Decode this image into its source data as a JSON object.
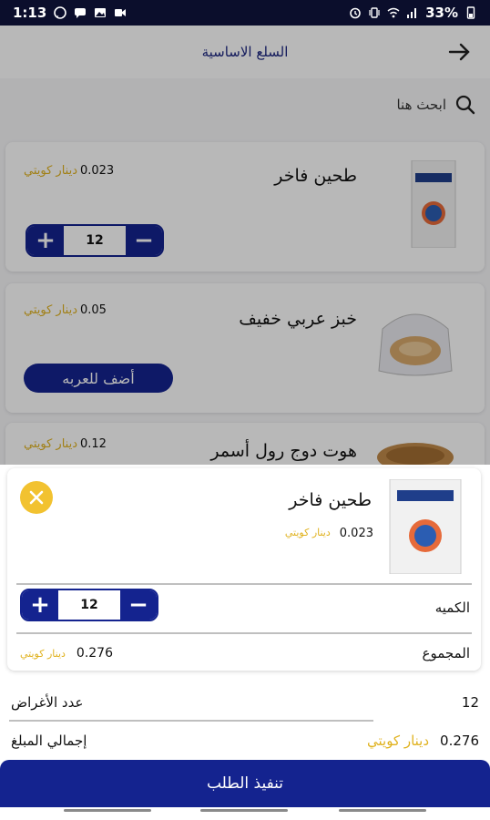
{
  "status_bar": {
    "time": "1:13",
    "battery": "33%",
    "icons": [
      "whatsapp-icon",
      "chat-icon",
      "gallery-icon",
      "video-icon",
      "alarm-icon",
      "vibrate-icon",
      "wifi-icon",
      "signal-icon",
      "battery-icon"
    ]
  },
  "header": {
    "title": "السلع الاساسية"
  },
  "search": {
    "placeholder": "ابحث هنا"
  },
  "products": [
    {
      "name": "طحين فاخر",
      "price": "0.023",
      "currency": "دينار كويتي",
      "quantity": "12",
      "thumb": "flour-bag"
    },
    {
      "name": "خبز عربي خفيف",
      "price": "0.05",
      "currency": "دينار كويتي",
      "button": "أضف للعربه",
      "thumb": "bread-bag"
    },
    {
      "name": "هوت دوج رول أسمر",
      "price": "0.12",
      "currency": "دينار كويتي",
      "thumb": "hotdog-rolls"
    }
  ],
  "detail": {
    "name": "طحين فاخر",
    "price": "0.023",
    "currency": "دينار كويتي",
    "quantity_label": "الكميه",
    "quantity": "12",
    "total_label": "المجموع",
    "total": "0.276",
    "total_currency": "دينار كويتي"
  },
  "summary": {
    "items_label": "عدد الأغراض",
    "items_count": "12",
    "amount_label": "إجمالي المبلغ",
    "amount": "0.276",
    "amount_currency": "دينار كويتي"
  },
  "checkout_label": "تنفيذ الطلب",
  "colors": {
    "primary": "#14238f",
    "accent": "#f2c230",
    "currency": "#e0b21f",
    "status_bar": "#0b0e2c"
  }
}
